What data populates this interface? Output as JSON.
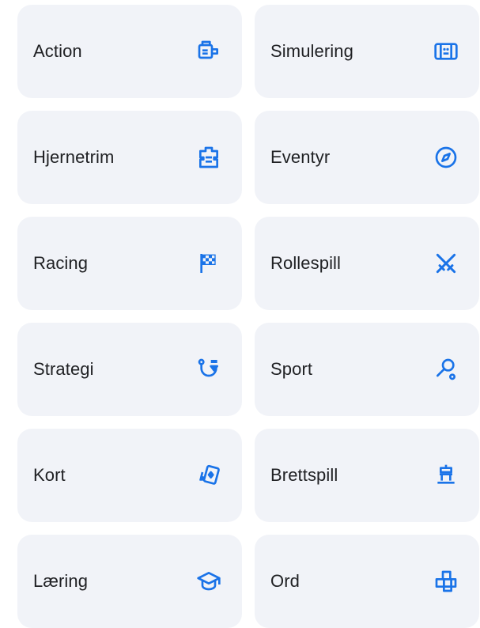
{
  "accent_color": "#1a73e8",
  "categories": [
    {
      "label": "Action",
      "icon": "gamepad-controller-icon"
    },
    {
      "label": "Simulering",
      "icon": "simulation-icon"
    },
    {
      "label": "Hjernetrim",
      "icon": "puzzle-piece-icon"
    },
    {
      "label": "Eventyr",
      "icon": "compass-icon"
    },
    {
      "label": "Racing",
      "icon": "checkered-flag-icon"
    },
    {
      "label": "Rollespill",
      "icon": "crossed-swords-icon"
    },
    {
      "label": "Strategi",
      "icon": "strategy-path-icon"
    },
    {
      "label": "Sport",
      "icon": "sport-icon"
    },
    {
      "label": "Kort",
      "icon": "playing-cards-icon"
    },
    {
      "label": "Brettspill",
      "icon": "board-game-icon"
    },
    {
      "label": "Læring",
      "icon": "graduation-cap-icon"
    },
    {
      "label": "Ord",
      "icon": "word-tiles-icon"
    }
  ]
}
